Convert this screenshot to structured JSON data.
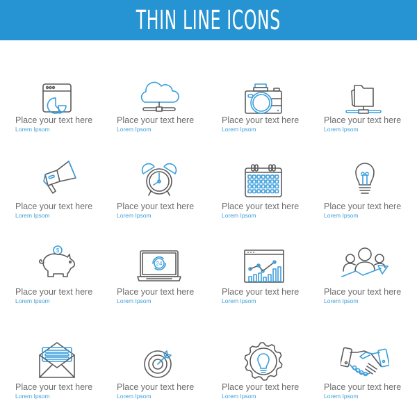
{
  "header": {
    "title": "THIN LINE ICONS",
    "background": "#2693d2"
  },
  "colors": {
    "accent": "#3a9edb",
    "line": "#5a5a5a",
    "text": "#6d6d6d"
  },
  "items": [
    {
      "icon": "web-analytics-icon",
      "title": "Place your text here",
      "subtitle": "Lorem Ipsom"
    },
    {
      "icon": "cloud-network-icon",
      "title": "Place your text here",
      "subtitle": "Lorem Ipsom"
    },
    {
      "icon": "camera-icon",
      "title": "Place your text here",
      "subtitle": "Lorem Ipsom"
    },
    {
      "icon": "folder-network-icon",
      "title": "Place your text here",
      "subtitle": "Lorem Ipsom"
    },
    {
      "icon": "megaphone-icon",
      "title": "Place your text here",
      "subtitle": "Lorem Ipsom"
    },
    {
      "icon": "alarm-clock-icon",
      "title": "Place your text here",
      "subtitle": "Lorem Ipsom"
    },
    {
      "icon": "calendar-icon",
      "title": "Place your text here",
      "subtitle": "Lorem Ipsom"
    },
    {
      "icon": "light-bulb-icon",
      "title": "Place your text here",
      "subtitle": "Lorem Ipsom"
    },
    {
      "icon": "piggy-bank-icon",
      "title": "Place your text here",
      "subtitle": "Lorem Ipsom"
    },
    {
      "icon": "laptop-24-support-icon",
      "title": "Place your text here",
      "subtitle": "Lorem Ipsom",
      "badge": "24"
    },
    {
      "icon": "growth-chart-icon",
      "title": "Place your text here",
      "subtitle": "Lorem Ipsom"
    },
    {
      "icon": "team-growth-icon",
      "title": "Place your text here",
      "subtitle": "Lorem Ipsom"
    },
    {
      "icon": "open-envelope-icon",
      "title": "Place your text here",
      "subtitle": "Lorem Ipsom"
    },
    {
      "icon": "target-icon",
      "title": "Place your text here",
      "subtitle": "Lorem Ipsom"
    },
    {
      "icon": "gear-idea-icon",
      "title": "Place your text here",
      "subtitle": "Lorem Ipsom"
    },
    {
      "icon": "handshake-icon",
      "title": "Place your text here",
      "subtitle": "Lorem Ipsom"
    }
  ],
  "piggy_symbol": "$"
}
